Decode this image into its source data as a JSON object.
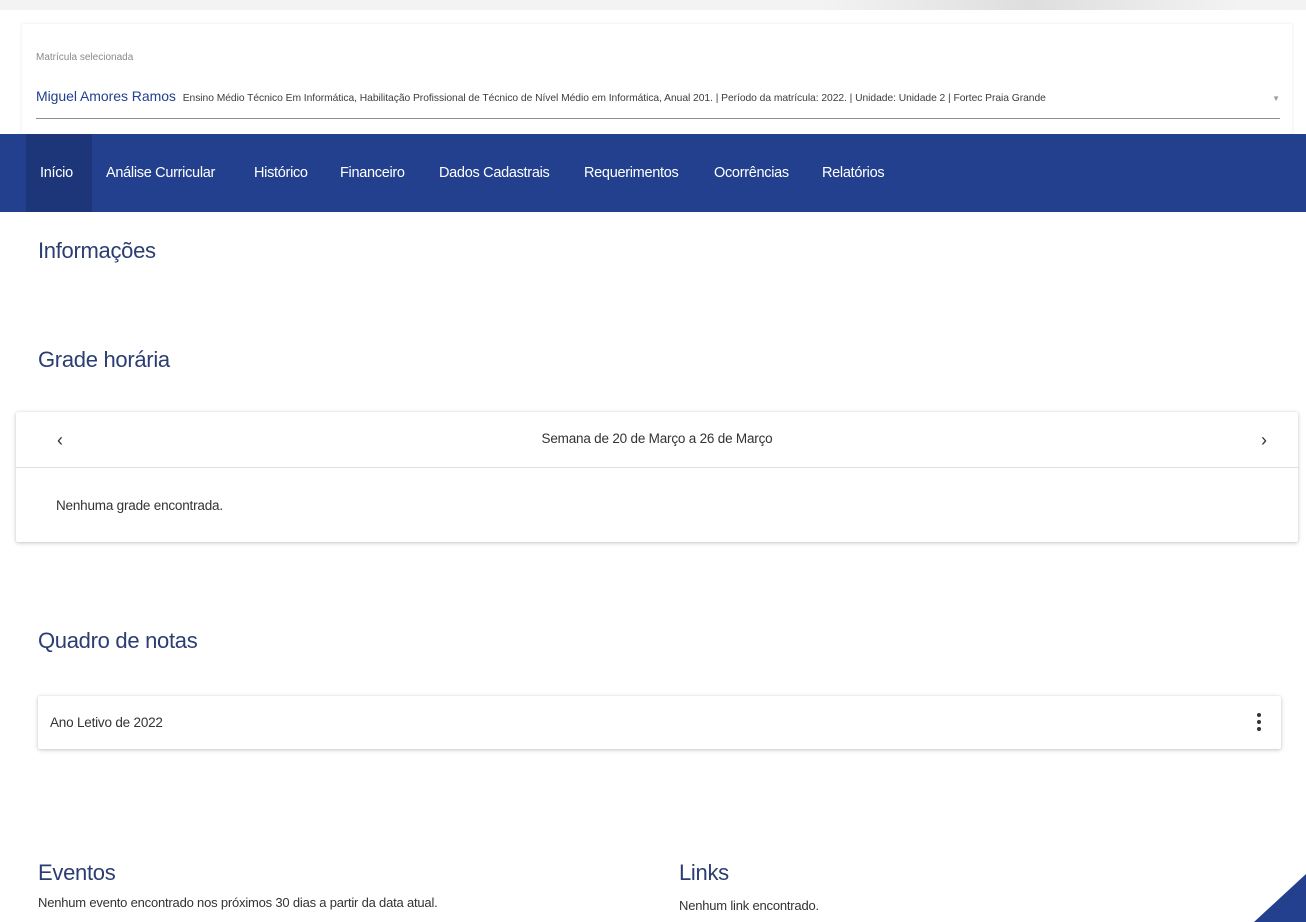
{
  "enrollment": {
    "caption": "Matrícula selecionada",
    "student_name": "Miguel Amores Ramos",
    "details": "Ensino Médio Técnico Em Informática, Habilitação Profissional de Técnico de Nível Médio em Informática, Anual 201. | Período da matrícula: 2022. | Unidade: Unidade 2 | Fortec Praia Grande"
  },
  "nav": {
    "items": [
      {
        "label": "Início"
      },
      {
        "label": "Análise Curricular"
      },
      {
        "label": "Histórico"
      },
      {
        "label": "Financeiro"
      },
      {
        "label": "Dados Cadastrais"
      },
      {
        "label": "Requerimentos"
      },
      {
        "label": "Ocorrências"
      },
      {
        "label": "Relatórios"
      }
    ]
  },
  "informacoes": {
    "title": "Informações"
  },
  "grade_horaria": {
    "title": "Grade horária",
    "week_label": "Semana de 20 de Março a 26 de Março",
    "prev_glyph": "‹",
    "next_glyph": "›",
    "empty_text": "Nenhuma grade encontrada."
  },
  "quadro_notas": {
    "title": "Quadro de notas",
    "item_label": "Ano Letivo de 2022"
  },
  "eventos": {
    "title": "Eventos",
    "empty_text": "Nenhum evento encontrado nos próximos 30 dias a partir da data atual."
  },
  "links": {
    "title": "Links",
    "empty_text": "Nenhum link encontrado."
  },
  "colors": {
    "primary": "#23408e",
    "heading": "#2b3d72"
  },
  "icons": {
    "prev": "chevron-left-icon",
    "next": "chevron-right-icon",
    "menu": "more-vert-icon",
    "dropdown": "dropdown-arrow-icon"
  }
}
